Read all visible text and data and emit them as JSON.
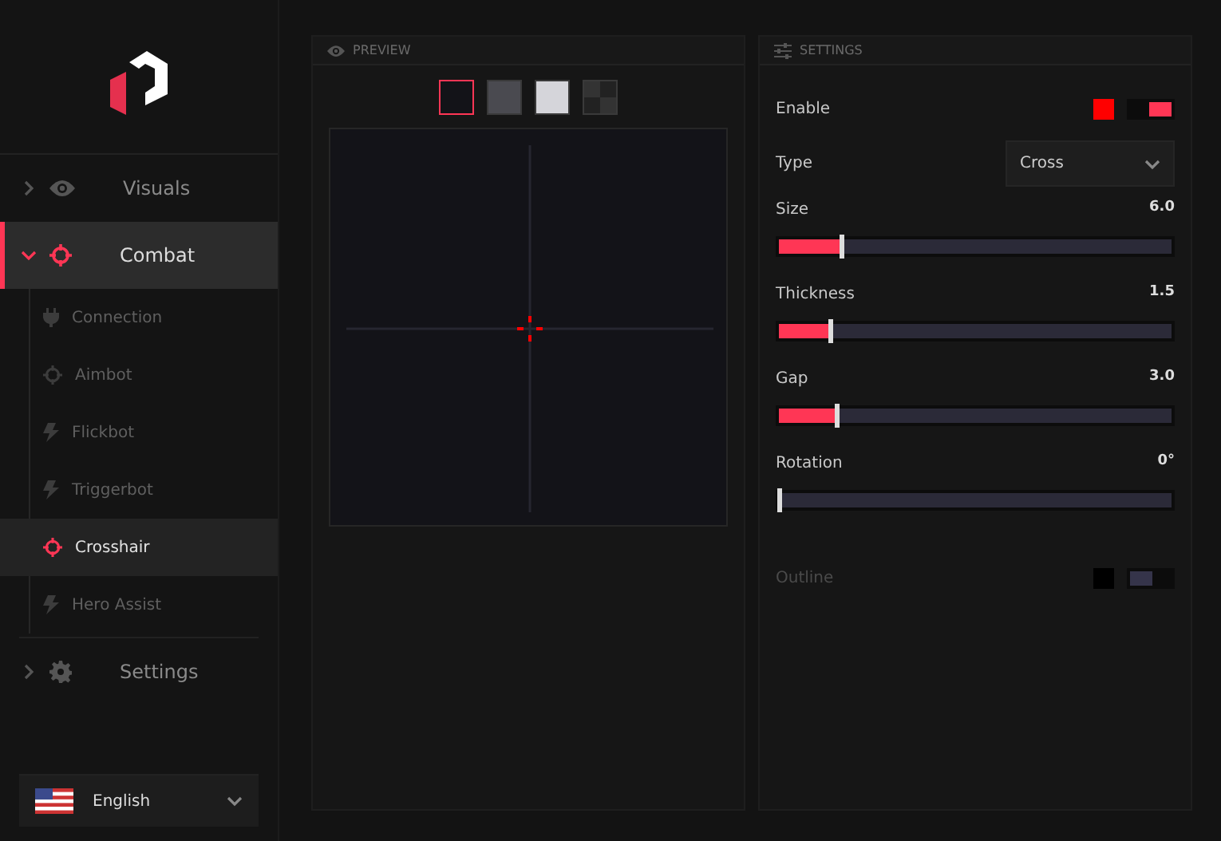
{
  "sidebar": {
    "nav": [
      {
        "label": "Visuals",
        "expanded": false,
        "selected": false
      },
      {
        "label": "Combat",
        "expanded": true,
        "selected": true,
        "children": [
          {
            "label": "Connection",
            "selected": false
          },
          {
            "label": "Aimbot",
            "selected": false
          },
          {
            "label": "Flickbot",
            "selected": false
          },
          {
            "label": "Triggerbot",
            "selected": false
          },
          {
            "label": "Crosshair",
            "selected": true
          },
          {
            "label": "Hero Assist",
            "selected": false
          }
        ]
      },
      {
        "label": "Settings",
        "expanded": false,
        "selected": false
      }
    ],
    "language": "English"
  },
  "preview": {
    "title": "PREVIEW",
    "backgrounds": [
      {
        "selected": true
      },
      {
        "selected": false
      },
      {
        "selected": false
      },
      {
        "selected": false
      }
    ]
  },
  "settings": {
    "title": "SETTINGS",
    "rows": [
      {
        "kind": "toggle",
        "label": "Enable",
        "color": "#ff0000",
        "on": true,
        "disabled": false
      },
      {
        "kind": "select",
        "label": "Type",
        "value": "Cross"
      },
      {
        "kind": "slider",
        "label": "Size",
        "reading": "6.0",
        "level": 0.16
      },
      {
        "kind": "slider",
        "label": "Thickness",
        "reading": "1.5",
        "level": 0.13
      },
      {
        "kind": "slider",
        "label": "Gap",
        "reading": "3.0",
        "level": 0.145
      },
      {
        "kind": "slider",
        "label": "Rotation",
        "reading": "0°",
        "level": 0
      },
      {
        "kind": "toggle",
        "label": "Outline",
        "color": "#000000",
        "on": false,
        "disabled": true
      }
    ]
  }
}
